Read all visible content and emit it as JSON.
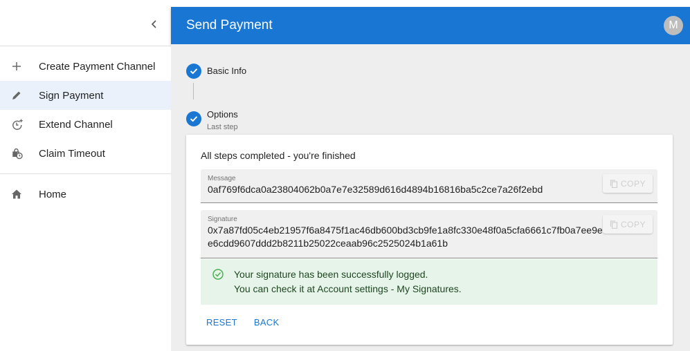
{
  "sidebar": {
    "collapse_icon": "chevron-left-icon",
    "items": [
      {
        "label": "Create Payment Channel",
        "icon": "plus-icon"
      },
      {
        "label": "Sign Payment",
        "icon": "pencil-icon"
      },
      {
        "label": "Extend Channel",
        "icon": "clock-plus-icon"
      },
      {
        "label": "Claim Timeout",
        "icon": "lock-clock-icon"
      }
    ],
    "home": {
      "label": "Home",
      "icon": "home-icon"
    }
  },
  "appbar": {
    "title": "Send Payment",
    "avatar_letter": "M",
    "color": "#1976d2"
  },
  "stepper": {
    "steps": [
      {
        "label": "Basic Info",
        "sub": ""
      },
      {
        "label": "Options",
        "sub": "Last step"
      }
    ]
  },
  "card": {
    "heading": "All steps completed - you're finished",
    "message": {
      "label": "Message",
      "value": "0af769f6dca0a23804062b0a7e7e32589d616d4894b16816ba5c2ce7a26f2ebd",
      "copy_label": "COPY"
    },
    "signature": {
      "label": "Signature",
      "value": "0x7a87fd05c4eb21957f6a8475f1ac46db600bd3cb9fe1a8fc330e48f0a5cfa6661c7fb0a7ee9e95d968f89e6cdd9607ddd2b8211b25022ceaab96c2525024b1a61b",
      "copy_label": "COPY"
    },
    "alert": {
      "line1": "Your signature has been successfully logged.",
      "line2": "You can check it at Account settings - My Signatures.",
      "color": "#e6f4ea"
    },
    "actions": {
      "reset": "RESET",
      "back": "BACK"
    }
  }
}
